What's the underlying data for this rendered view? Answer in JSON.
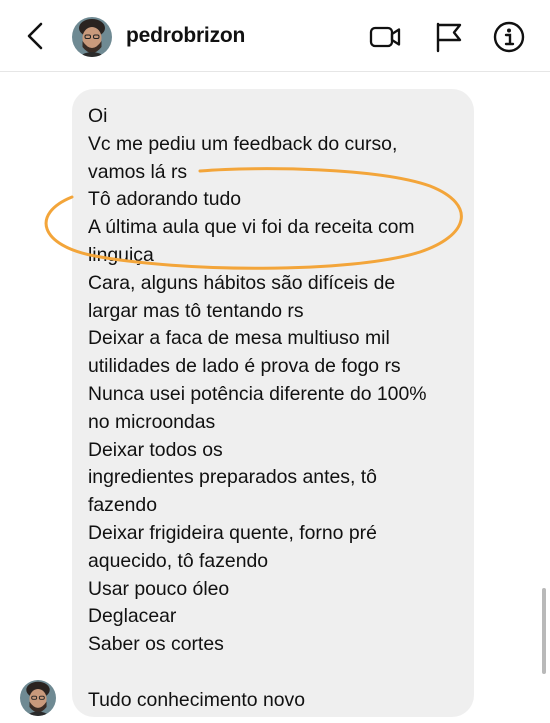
{
  "header": {
    "username": "pedrobrizon",
    "icons": [
      "back-arrow-icon",
      "video-call-icon",
      "flag-icon",
      "info-icon"
    ]
  },
  "message": {
    "lines": [
      "Oi",
      "Vc me pediu um feedback do curso,",
      "vamos lá rs",
      "Tô adorando tudo",
      "A última aula que vi foi da receita com",
      "linguiça",
      "Cara, alguns hábitos são difíceis de",
      "largar mas tô tentando rs",
      "Deixar a faca de mesa multiuso mil",
      "utilidades de lado é prova de fogo rs",
      "Nunca usei potência diferente do 100%",
      "no microondas",
      "Deixar todos os",
      "ingredientes preparados antes, tô",
      "fazendo",
      "Deixar frigideira quente, forno pré",
      "aquecido, tô fazendo",
      "Usar pouco óleo",
      "Deglacear",
      "Saber os cortes",
      "",
      "Tudo conhecimento novo"
    ]
  },
  "colors": {
    "bubble": "#efefef",
    "annotation": "#f3a53a",
    "divider": "#e6e6e6"
  }
}
